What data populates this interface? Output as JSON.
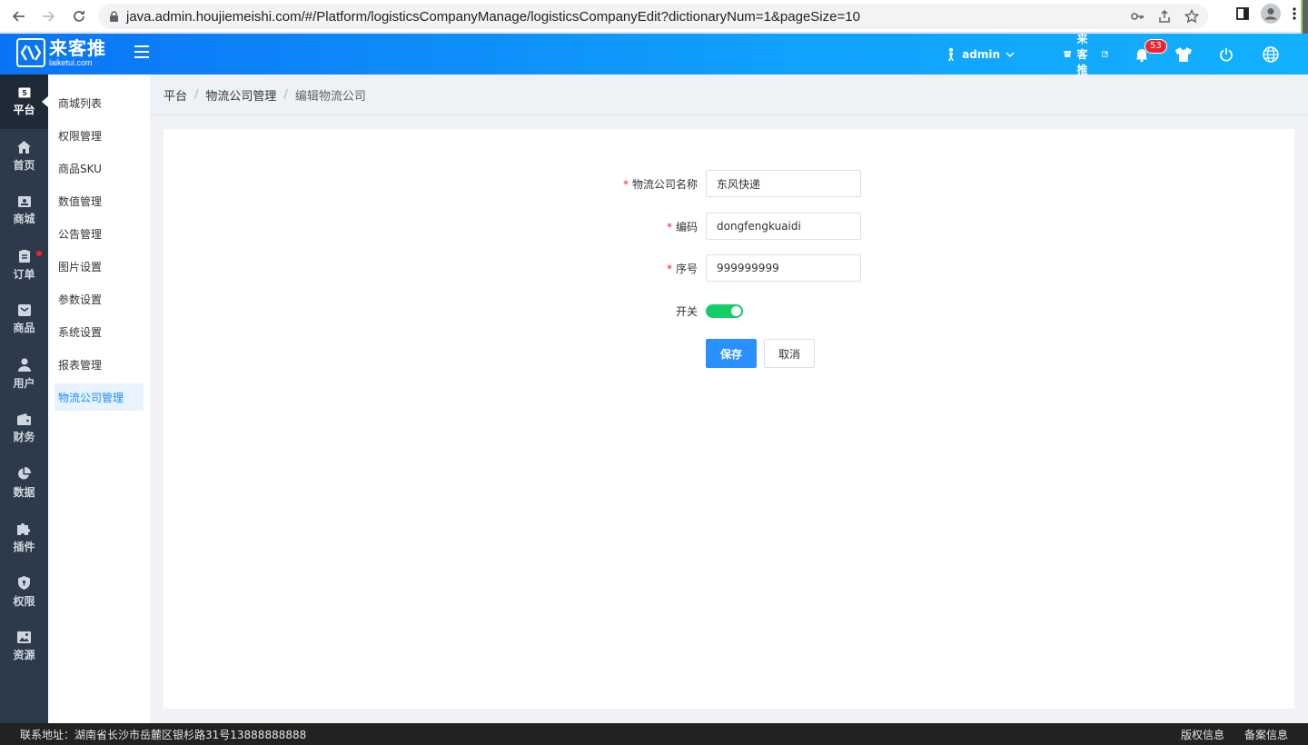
{
  "browser": {
    "url": "java.admin.houjiemeishi.com/#/Platform/logisticsCompanyManage/logisticsCompanyEdit?dictionaryNum=1&pageSize=10"
  },
  "header": {
    "logo_main": "来客推",
    "logo_sub": "laiketui.com",
    "user": "admin",
    "store": "来客推",
    "notification_count": "53"
  },
  "sidebar": {
    "items": [
      {
        "label": "平台",
        "icon": "platform-icon"
      },
      {
        "label": "首页",
        "icon": "home-icon"
      },
      {
        "label": "商城",
        "icon": "mall-icon"
      },
      {
        "label": "订单",
        "icon": "order-icon"
      },
      {
        "label": "商品",
        "icon": "goods-icon"
      },
      {
        "label": "用户",
        "icon": "user-icon"
      },
      {
        "label": "财务",
        "icon": "wallet-icon"
      },
      {
        "label": "数据",
        "icon": "pie-chart-icon"
      },
      {
        "label": "插件",
        "icon": "puzzle-icon"
      },
      {
        "label": "权限",
        "icon": "shield-icon"
      },
      {
        "label": "资源",
        "icon": "image-icon"
      }
    ]
  },
  "submenu": {
    "items": [
      {
        "label": "商城列表"
      },
      {
        "label": "权限管理"
      },
      {
        "label": "商品SKU"
      },
      {
        "label": "数值管理"
      },
      {
        "label": "公告管理"
      },
      {
        "label": "图片设置"
      },
      {
        "label": "参数设置"
      },
      {
        "label": "系统设置"
      },
      {
        "label": "报表管理"
      },
      {
        "label": "物流公司管理"
      }
    ]
  },
  "breadcrumb": {
    "items": [
      "平台",
      "物流公司管理",
      "编辑物流公司"
    ],
    "separator": "/"
  },
  "form": {
    "name_label": "物流公司名称",
    "name_value": "东风快递",
    "code_label": "编码",
    "code_value": "dongfengkuaidi",
    "order_label": "序号",
    "order_value": "999999999",
    "switch_label": "开关",
    "switch_on": true,
    "required_mark": "*",
    "save_label": "保存",
    "cancel_label": "取消"
  },
  "footer": {
    "address": "联系地址：湖南省长沙市岳麓区银杉路31号13888888888",
    "copyright": "版权信息",
    "record": "备案信息"
  },
  "colors": {
    "header_gradient_start": "#0a74f5",
    "header_gradient_end": "#12b0ff",
    "sidebar_dark": "#2d3a4b",
    "primary": "#2890ff",
    "switch_on": "#13ce66",
    "active_submenu_bg": "#e8f3ff"
  }
}
